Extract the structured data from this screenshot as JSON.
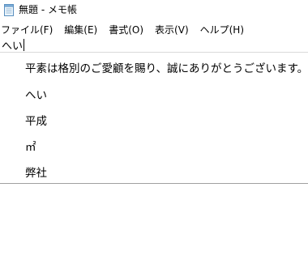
{
  "titlebar": {
    "title": "無題 - メモ帳",
    "icon": "notepad-icon"
  },
  "menubar": {
    "items": [
      {
        "label": "ファイル(F)"
      },
      {
        "label": "編集(E)"
      },
      {
        "label": "書式(O)"
      },
      {
        "label": "表示(V)"
      },
      {
        "label": "ヘルプ(H)"
      }
    ]
  },
  "editor": {
    "composition_text": "へい"
  },
  "ime": {
    "candidates": [
      "平素は格別のご愛顧を賜り、誠にありがとうございます。",
      "へい",
      "平成",
      "㎡",
      "弊社"
    ]
  }
}
